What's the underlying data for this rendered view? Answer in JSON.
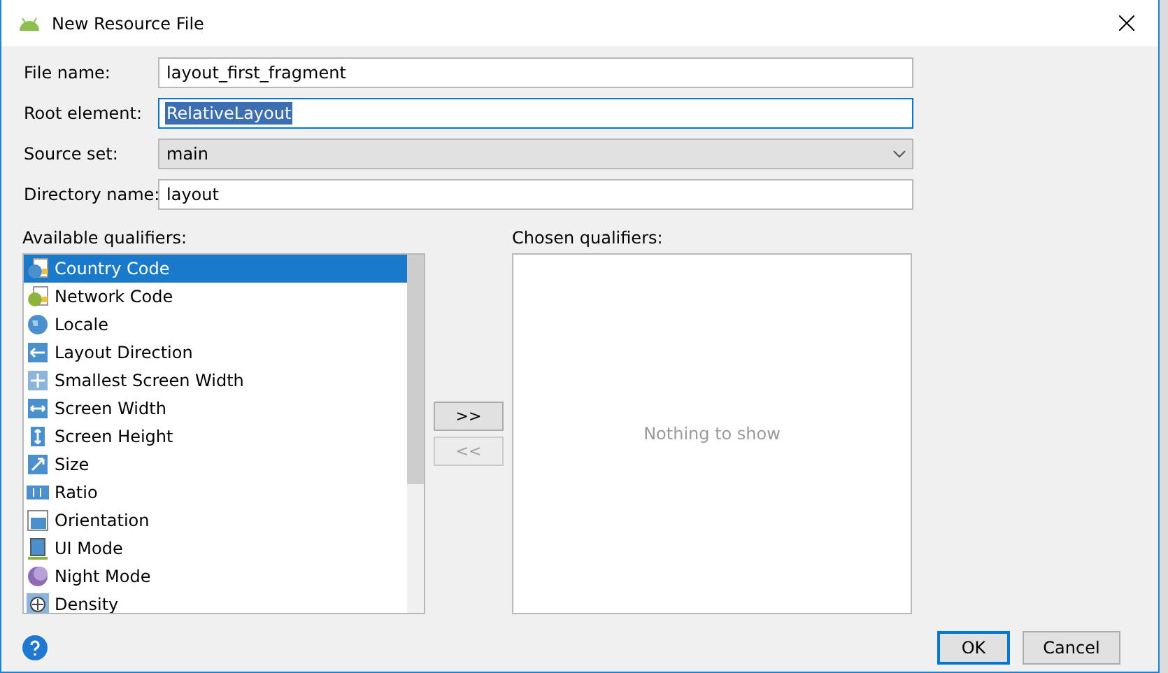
{
  "window": {
    "title": "New Resource File"
  },
  "fields": [
    {
      "label": "File name:",
      "kind": "text",
      "value": "layout_first_fragment",
      "focused": false,
      "selected_text": false
    },
    {
      "label": "Root element:",
      "kind": "text",
      "value": "RelativeLayout",
      "focused": true,
      "selected_text": true
    },
    {
      "label": "Source set:",
      "kind": "dropdown",
      "value": "main",
      "focused": false,
      "selected_text": false
    },
    {
      "label": "Directory name:",
      "kind": "text",
      "value": "layout",
      "focused": false,
      "selected_text": false
    }
  ],
  "available": {
    "label": "Available qualifiers:",
    "items": [
      {
        "label": "Country Code",
        "selected": true
      },
      {
        "label": "Network Code",
        "selected": false
      },
      {
        "label": "Locale",
        "selected": false
      },
      {
        "label": "Layout Direction",
        "selected": false
      },
      {
        "label": "Smallest Screen Width",
        "selected": false
      },
      {
        "label": "Screen Width",
        "selected": false
      },
      {
        "label": "Screen Height",
        "selected": false
      },
      {
        "label": "Size",
        "selected": false
      },
      {
        "label": "Ratio",
        "selected": false
      },
      {
        "label": "Orientation",
        "selected": false
      },
      {
        "label": "UI Mode",
        "selected": false
      },
      {
        "label": "Night Mode",
        "selected": false
      },
      {
        "label": "Density",
        "selected": false
      }
    ]
  },
  "move_buttons": [
    {
      "label": ">>",
      "disabled": false
    },
    {
      "label": "<<",
      "disabled": true
    }
  ],
  "chosen": {
    "label": "Chosen qualifiers:",
    "empty_text": "Nothing to show"
  },
  "buttons": [
    {
      "label": "OK",
      "default": true
    },
    {
      "label": "Cancel",
      "default": false
    }
  ]
}
